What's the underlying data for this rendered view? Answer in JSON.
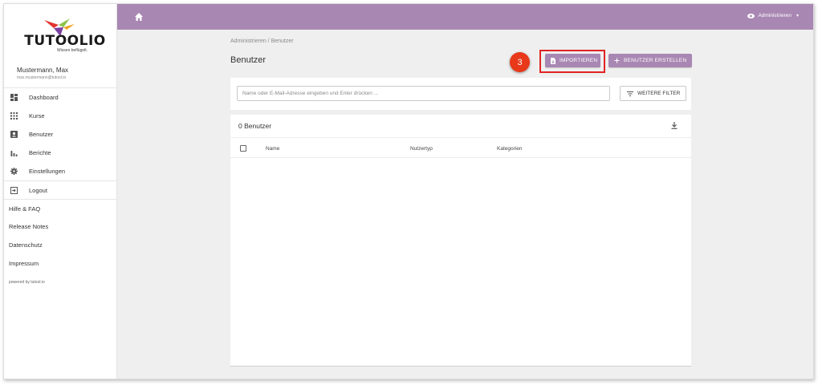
{
  "sidebar": {
    "logo_text": "TUTOOLIO",
    "logo_tagline": "Wissen beflügelt.",
    "user_name": "Mustermann, Max",
    "user_email": "max.mustermann@tutool.io",
    "nav_items": [
      {
        "label": "Dashboard",
        "icon": "dashboard-icon"
      },
      {
        "label": "Kurse",
        "icon": "grid-icon"
      },
      {
        "label": "Benutzer",
        "icon": "user-card-icon"
      },
      {
        "label": "Berichte",
        "icon": "bar-chart-icon"
      },
      {
        "label": "Einstellungen",
        "icon": "gear-icon"
      }
    ],
    "logout_label": "Logout",
    "links": [
      "Hilfe & FAQ",
      "Release Notes",
      "Datenschutz",
      "Impressum"
    ],
    "powered_by": "powered by tutool.io"
  },
  "topbar": {
    "admin_label": "Administrieren",
    "accent": "#a987b3"
  },
  "main": {
    "breadcrumb": "Administrieren  /  Benutzer",
    "title": "Benutzer",
    "step_number": "3",
    "import_label": "IMPORTIEREN",
    "create_label": "BENUTZER ERSTELLEN",
    "search_placeholder": "Name oder E-Mail-Adresse eingeben und Enter drücken ...",
    "filter_label": "WEITERE FILTER",
    "table_title": "0 Benutzer",
    "columns": [
      "Name",
      "Nutzertyp",
      "Kategorien"
    ]
  }
}
